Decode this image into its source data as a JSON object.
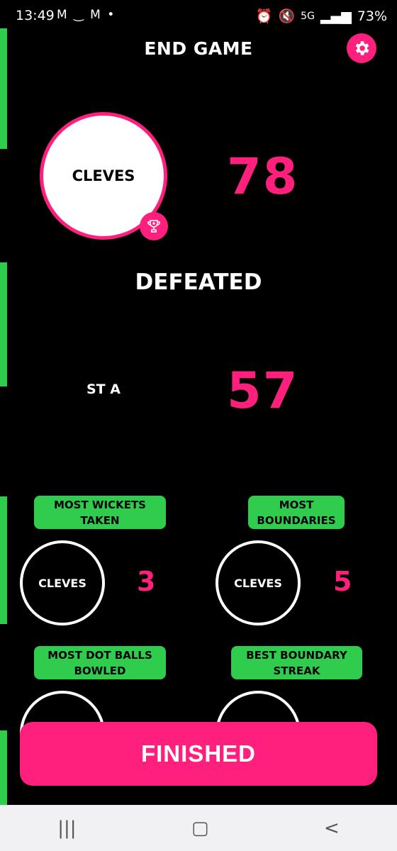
{
  "status": {
    "time": "13:49",
    "left_icons": "M ‿ M •",
    "signal_tag": "5G",
    "battery": "73%"
  },
  "header": {
    "title": "END GAME"
  },
  "winner": {
    "team": "CLEVES",
    "score": "78"
  },
  "result": "DEFEATED",
  "loser": {
    "team": "ST A",
    "score": "57"
  },
  "stats": [
    {
      "label": "MOST WICKETS TAKEN",
      "team": "CLEVES",
      "value": "3"
    },
    {
      "label": "MOST BOUNDARIES",
      "team": "CLEVES",
      "value": "5"
    },
    {
      "label": "MOST DOT BALLS BOWLED",
      "team": "",
      "value": ""
    },
    {
      "label": "BEST BOUNDARY STREAK",
      "team": "",
      "value": ""
    }
  ],
  "finish_button": "FINISHED",
  "colors": {
    "accent": "#ff1f7c",
    "green": "#2fcc4e",
    "background": "#000000"
  },
  "icons": [
    "settings-gear-icon",
    "trophy-icon",
    "recents-icon",
    "home-icon",
    "back-icon"
  ]
}
